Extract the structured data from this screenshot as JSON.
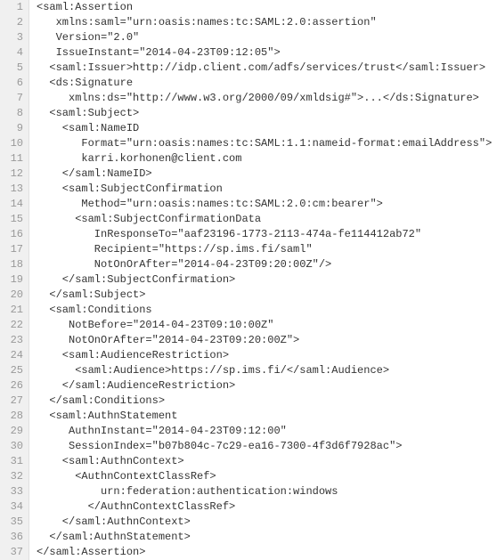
{
  "code_lines": [
    "<saml:Assertion",
    "   xmlns:saml=\"urn:oasis:names:tc:SAML:2.0:assertion\"",
    "   Version=\"2.0\"",
    "   IssueInstant=\"2014-04-23T09:12:05\">",
    "  <saml:Issuer>http://idp.client.com/adfs/services/trust</saml:Issuer>",
    "  <ds:Signature",
    "     xmlns:ds=\"http://www.w3.org/2000/09/xmldsig#\">...</ds:Signature>",
    "  <saml:Subject>",
    "    <saml:NameID",
    "       Format=\"urn:oasis:names:tc:SAML:1.1:nameid-format:emailAddress\">",
    "       karri.korhonen@client.com",
    "    </saml:NameID>",
    "    <saml:SubjectConfirmation",
    "       Method=\"urn:oasis:names:tc:SAML:2.0:cm:bearer\">",
    "      <saml:SubjectConfirmationData",
    "         InResponseTo=\"aaf23196-1773-2113-474a-fe114412ab72\"",
    "         Recipient=\"https://sp.ims.fi/saml\"",
    "         NotOnOrAfter=\"2014-04-23T09:20:00Z\"/>",
    "    </saml:SubjectConfirmation>",
    "  </saml:Subject>",
    "  <saml:Conditions",
    "     NotBefore=\"2014-04-23T09:10:00Z\"",
    "     NotOnOrAfter=\"2014-04-23T09:20:00Z\">",
    "    <saml:AudienceRestriction>",
    "      <saml:Audience>https://sp.ims.fi/</saml:Audience>",
    "    </saml:AudienceRestriction>",
    "  </saml:Conditions>",
    "  <saml:AuthnStatement",
    "     AuthnInstant=\"2014-04-23T09:12:00\"",
    "     SessionIndex=\"b07b804c-7c29-ea16-7300-4f3d6f7928ac\">",
    "    <saml:AuthnContext>",
    "      <AuthnContextClassRef>",
    "          urn:federation:authentication:windows",
    "        </AuthnContextClassRef>",
    "    </saml:AuthnContext>",
    "  </saml:AuthnStatement>",
    "</saml:Assertion>"
  ]
}
